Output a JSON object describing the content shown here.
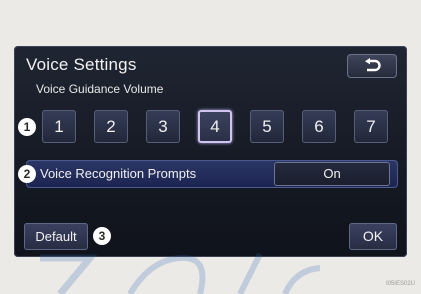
{
  "screen": {
    "title": "Voice Settings",
    "back_icon": "return-arrow-icon"
  },
  "voice_guidance_volume": {
    "label": "Voice Guidance Volume",
    "options": [
      "1",
      "2",
      "3",
      "4",
      "5",
      "6",
      "7"
    ],
    "selected": "4"
  },
  "voice_recognition_prompts": {
    "label": "Voice Recognition Prompts",
    "value": "On"
  },
  "buttons": {
    "default": "Default",
    "ok": "OK"
  },
  "callouts": [
    "1",
    "2",
    "3"
  ],
  "image_code": "I05IES02U",
  "colors": {
    "screen_bg": "#1f2532",
    "button_bg": "#353c57",
    "selected_outline": "#cfc3ef",
    "prompt_bar": "#2c3766",
    "watermark": "#2a64b8"
  }
}
